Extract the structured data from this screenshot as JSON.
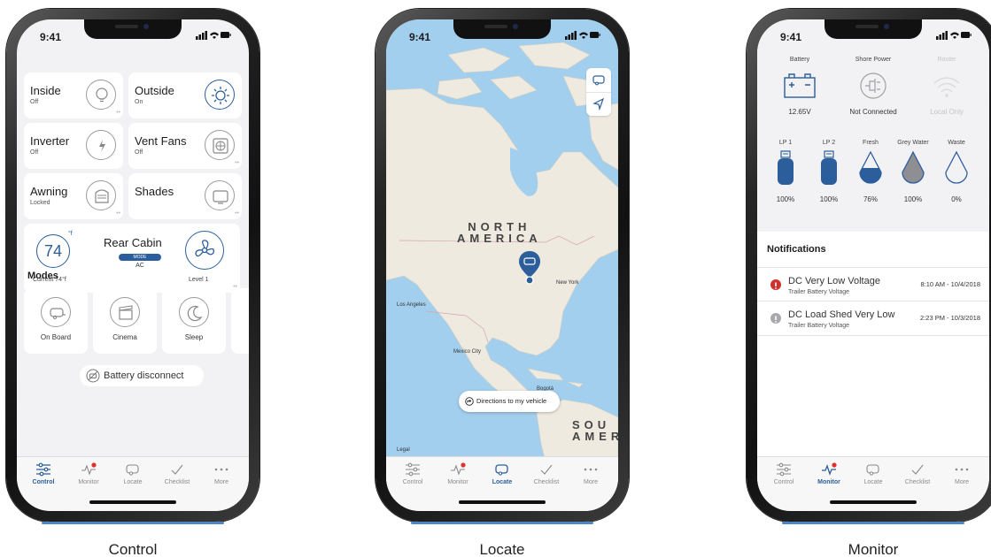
{
  "status_time": "9:41",
  "tabs": [
    {
      "label": "Control",
      "icon": "sliders-icon"
    },
    {
      "label": "Monitor",
      "icon": "pulse-icon"
    },
    {
      "label": "Locate",
      "icon": "trailer-icon"
    },
    {
      "label": "Checklist",
      "icon": "checkmark-icon"
    },
    {
      "label": "More",
      "icon": "ellipsis-icon"
    }
  ],
  "colors": {
    "accent": "#2b5e9a",
    "alert_red": "#d0312d",
    "badge_red": "#e0312d",
    "map_water": "#a3cfee",
    "map_land": "#efeae0"
  },
  "control": {
    "caption": "Control",
    "cards": [
      {
        "title": "Inside",
        "status": "Off",
        "icon": "lightbulb-icon",
        "on": false
      },
      {
        "title": "Outside",
        "status": "On",
        "icon": "sun-icon",
        "on": true
      },
      {
        "title": "Inverter",
        "status": "Off",
        "icon": "bolt-icon",
        "on": false
      },
      {
        "title": "Vent Fans",
        "status": "Off",
        "icon": "fan-icon",
        "on": false
      },
      {
        "title": "Awning",
        "status": "Locked",
        "icon": "awning-icon",
        "on": false
      },
      {
        "title": "Shades",
        "status": "",
        "icon": "shade-icon",
        "on": false
      }
    ],
    "climate": {
      "temperature": "74",
      "unit": "°f",
      "name": "Rear Cabin",
      "mode_label": "MODE",
      "mode_value": "AC",
      "current": "Current 74°f",
      "fan_level": "Level 1"
    },
    "modes_title": "Modes",
    "modes": [
      {
        "label": "On Board",
        "icon": "trailer-icon"
      },
      {
        "label": "Cinema",
        "icon": "clapperboard-icon"
      },
      {
        "label": "Sleep",
        "icon": "moon-icon"
      }
    ],
    "battery_disconnect": "Battery disconnect"
  },
  "locate": {
    "caption": "Locate",
    "continent_north": "NORTH\nAMERICA",
    "continent_south": "SOU\nAMER",
    "cities": [
      "New York",
      "Los Angeles",
      "Mexico City",
      "Bogotá"
    ],
    "legal": "Legal",
    "directions": "Directions to my vehicle"
  },
  "monitor": {
    "caption": "Monitor",
    "power": [
      {
        "label": "Battery",
        "value": "12.65V",
        "icon": "battery-icon"
      },
      {
        "label": "Shore Power",
        "value": "Not Connected",
        "icon": "plug-icon"
      },
      {
        "label": "Router",
        "value": "Local Only",
        "icon": "wifi-icon"
      }
    ],
    "tanks": [
      {
        "label": "LP 1",
        "value": "100%",
        "level": 1.0,
        "icon": "propane-tank-icon"
      },
      {
        "label": "LP 2",
        "value": "100%",
        "level": 1.0,
        "icon": "propane-tank-icon"
      },
      {
        "label": "Fresh",
        "value": "76%",
        "level": 0.76,
        "icon": "water-drop-icon"
      },
      {
        "label": "Grey Water",
        "value": "100%",
        "level": 1.0,
        "icon": "water-drop-icon"
      },
      {
        "label": "Waste",
        "value": "0%",
        "level": 0.0,
        "icon": "water-drop-icon"
      }
    ],
    "notifications_title": "Notifications",
    "notifications": [
      {
        "title": "DC Very Low Voltage",
        "subtitle": "Trailer Battery Voltage",
        "time": "8:10 AM - 10/4/2018",
        "severity": "alert"
      },
      {
        "title": "DC Load Shed Very Low",
        "subtitle": "Trailer Battery Voltage",
        "time": "2:23 PM - 10/3/2018",
        "severity": "info"
      }
    ]
  }
}
